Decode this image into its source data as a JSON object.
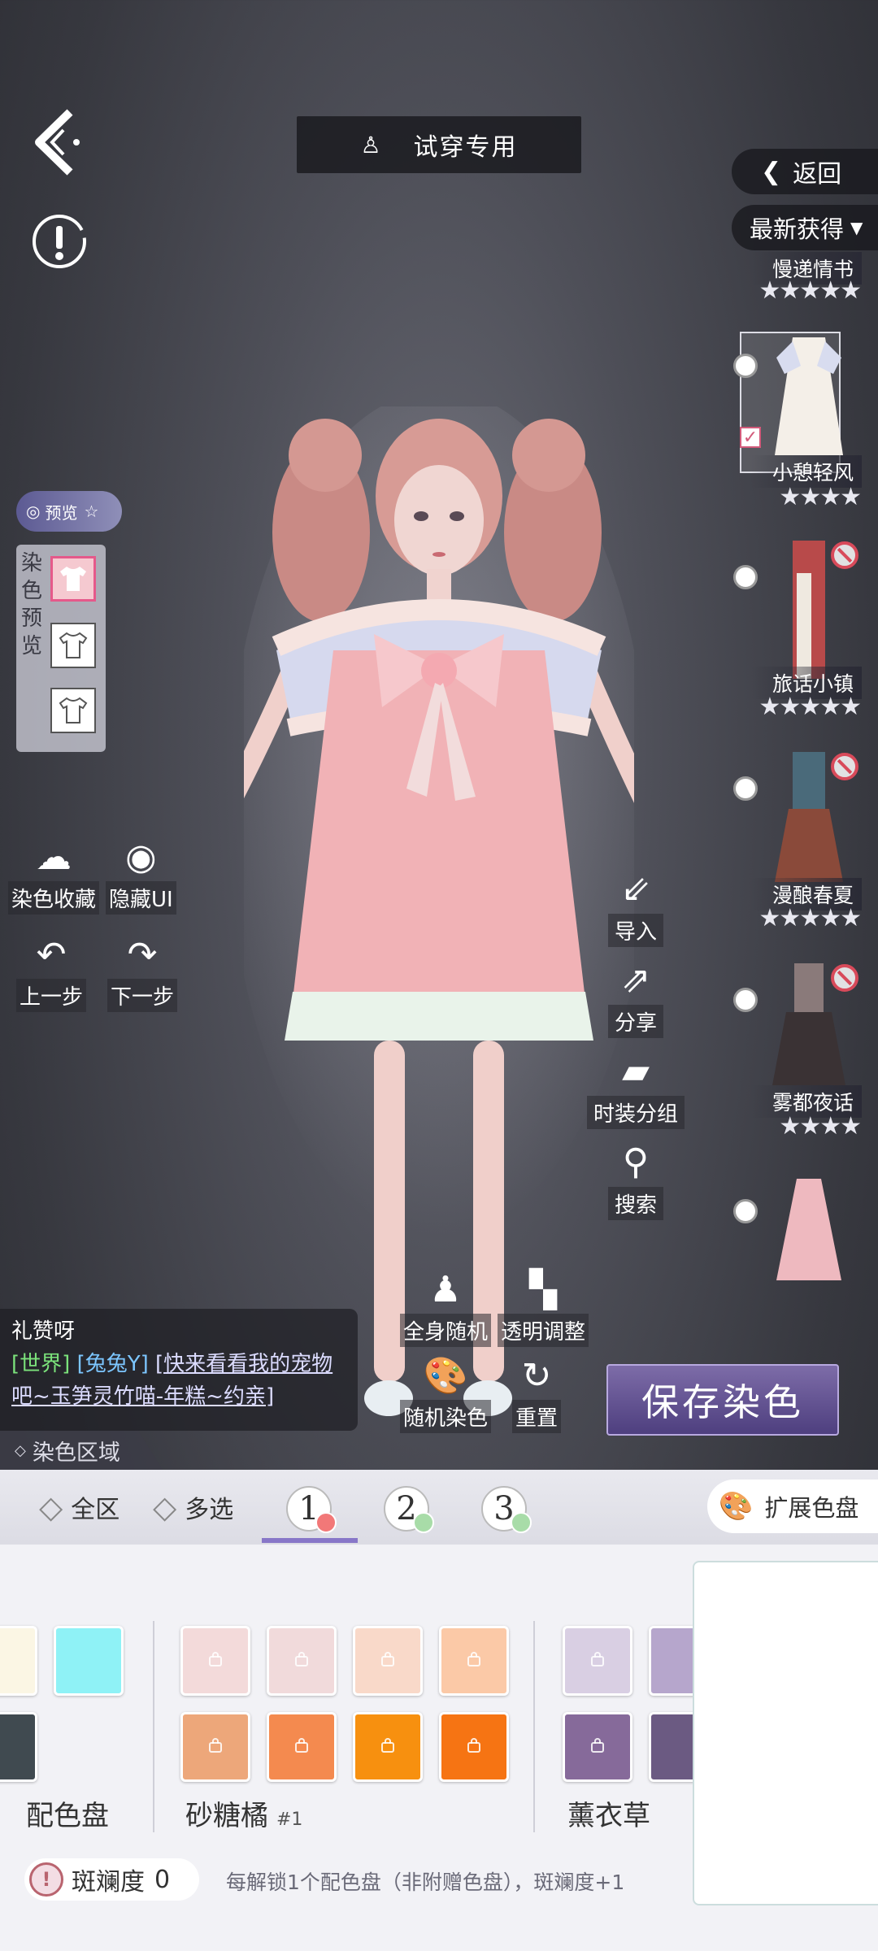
{
  "top": {
    "title": "试穿专用",
    "return_label": "返回",
    "sort_label": "最新获得"
  },
  "preview": {
    "pill_label": "预览",
    "panel_label": "染色预览"
  },
  "left_tools": {
    "dye_collect": "染色收藏",
    "hide_ui": "隐藏UI",
    "undo": "上一步",
    "redo": "下一步"
  },
  "right_tools": {
    "import": "导入",
    "share": "分享",
    "group": "时装分组",
    "search": "搜索"
  },
  "center_tools": {
    "full_random": "全身随机",
    "transparency": "透明调整",
    "random_dye": "随机染色",
    "reset": "重置"
  },
  "outfits": [
    {
      "name": "慢递情书",
      "stars": "★★★★★"
    },
    {
      "name": "小憩轻风",
      "stars": "★★★★"
    },
    {
      "name": "旅话小镇",
      "stars": "★★★★★"
    },
    {
      "name": "漫酿春夏",
      "stars": "★★★★★"
    },
    {
      "name": "雾都夜话",
      "stars": "★★★★"
    }
  ],
  "chat": {
    "line1": "礼赞呀",
    "channel": "[世界]",
    "sender": "[兔兔Y]",
    "message": "[快来看看我的宠物吧~玉笋灵竹喵-年糕~约亲]"
  },
  "save_label": "保存染色",
  "dye_region": {
    "label": "染色区域",
    "all": "全区",
    "multi": "多选",
    "slots": [
      "1",
      "2",
      "3"
    ],
    "slot_colors": [
      "#f27878",
      "#a8dca8",
      "#a8dca8"
    ],
    "expand_label": "扩展色盘"
  },
  "palettes": [
    {
      "name": "配色盘",
      "sub": ""
    },
    {
      "name": "砂糖橘",
      "sub": "#1"
    },
    {
      "name": "薰衣草",
      "sub": ""
    }
  ],
  "palette_colors": {
    "left": [
      "#fbf6e4",
      "#8ff2f6",
      "#404a50"
    ],
    "sugar_orange": [
      "#f3dada",
      "#f1dadb",
      "#f9d9c9",
      "#fbc9a7",
      "#eda77a",
      "#f48a4f",
      "#f7900f",
      "#f67413"
    ],
    "lavender": [
      "#d9cfe3",
      "#b6a6cc",
      "#866a9a",
      "#6b5a82"
    ]
  },
  "spots": {
    "label": "斑斓度",
    "value": "0",
    "hint": "每解锁1个配色盘（非附赠色盘），斑斓度+1"
  }
}
